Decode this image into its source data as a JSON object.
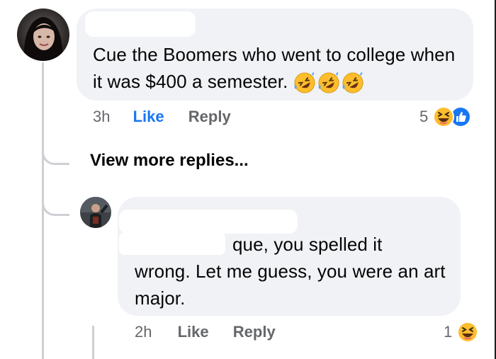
{
  "comments": [
    {
      "text": "Cue the Boomers who went to college when it was $400 a semester.",
      "time": "3h",
      "like_label": "Like",
      "reply_label": "Reply",
      "reaction_count": "5",
      "emoji_icons": [
        "rolling-laughing-icon",
        "rolling-laughing-icon",
        "rolling-laughing-icon"
      ],
      "reaction_icons": [
        "laughing-reaction-icon",
        "like-reaction-icon"
      ]
    },
    {
      "text_line1": "que, you spelled it",
      "text_rest": "wrong. Let me guess, you were an art major.",
      "time": "2h",
      "like_label": "Like",
      "reply_label": "Reply",
      "reaction_count": "1",
      "reaction_icons": [
        "laughing-reaction-icon"
      ]
    }
  ],
  "view_more": "View more replies...",
  "colors": {
    "like_active": "#1877f2",
    "bubble": "#f0f2f5",
    "meta": "#65676b",
    "thread_line": "#ced0d4"
  }
}
